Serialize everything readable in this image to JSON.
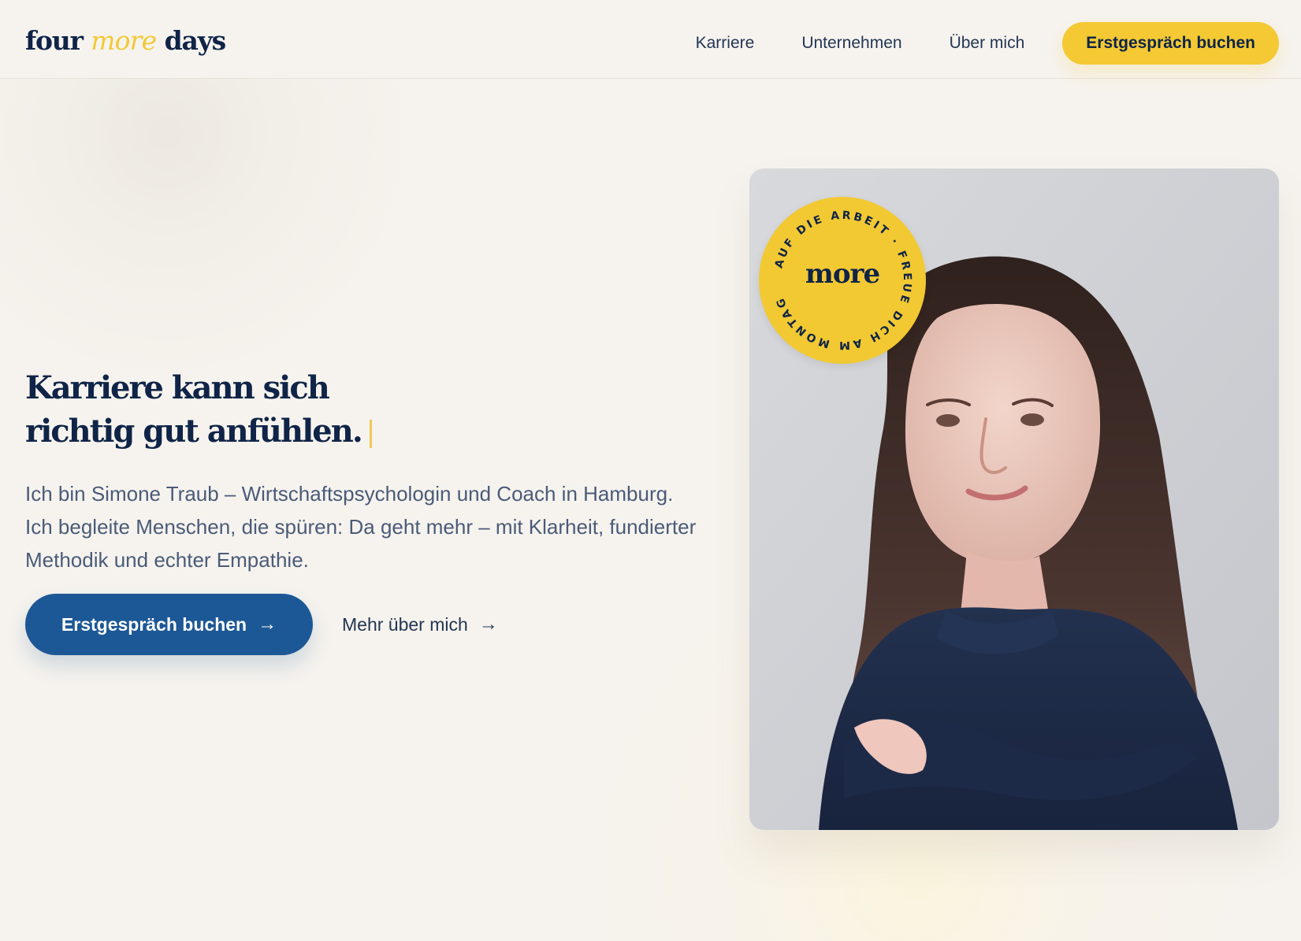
{
  "header": {
    "logo": {
      "part1": "four ",
      "part2": "more",
      "part3": " days"
    },
    "nav": [
      {
        "label": "Karriere"
      },
      {
        "label": "Unternehmen"
      },
      {
        "label": "Über mich"
      }
    ],
    "cta_label": "Erstgespräch buchen"
  },
  "hero": {
    "title_line1": "Karriere kann sich",
    "title_line2": "richtig gut anfühlen.",
    "description": "Ich bin Simone Traub – Wirtschaftspsychologin und Coach in Hamburg. Ich begleite Menschen, die spüren: Da geht mehr – mit Klarheit, fundierter Methodik und echter Empathie.",
    "primary_cta": "Erstgespräch buchen",
    "secondary_cta": "Mehr über mich"
  },
  "badge": {
    "center_text": "more",
    "ring_text": "AUF DIE ARBEIT · FREUE DICH AM MONTAG"
  },
  "icons": {
    "arrow_right": "arrow-right-icon"
  },
  "colors": {
    "background": "#f6f3ee",
    "navy": "#0f2447",
    "yellow": "#f4c934",
    "blue": "#1d5896",
    "text_muted": "#4a5b78"
  }
}
